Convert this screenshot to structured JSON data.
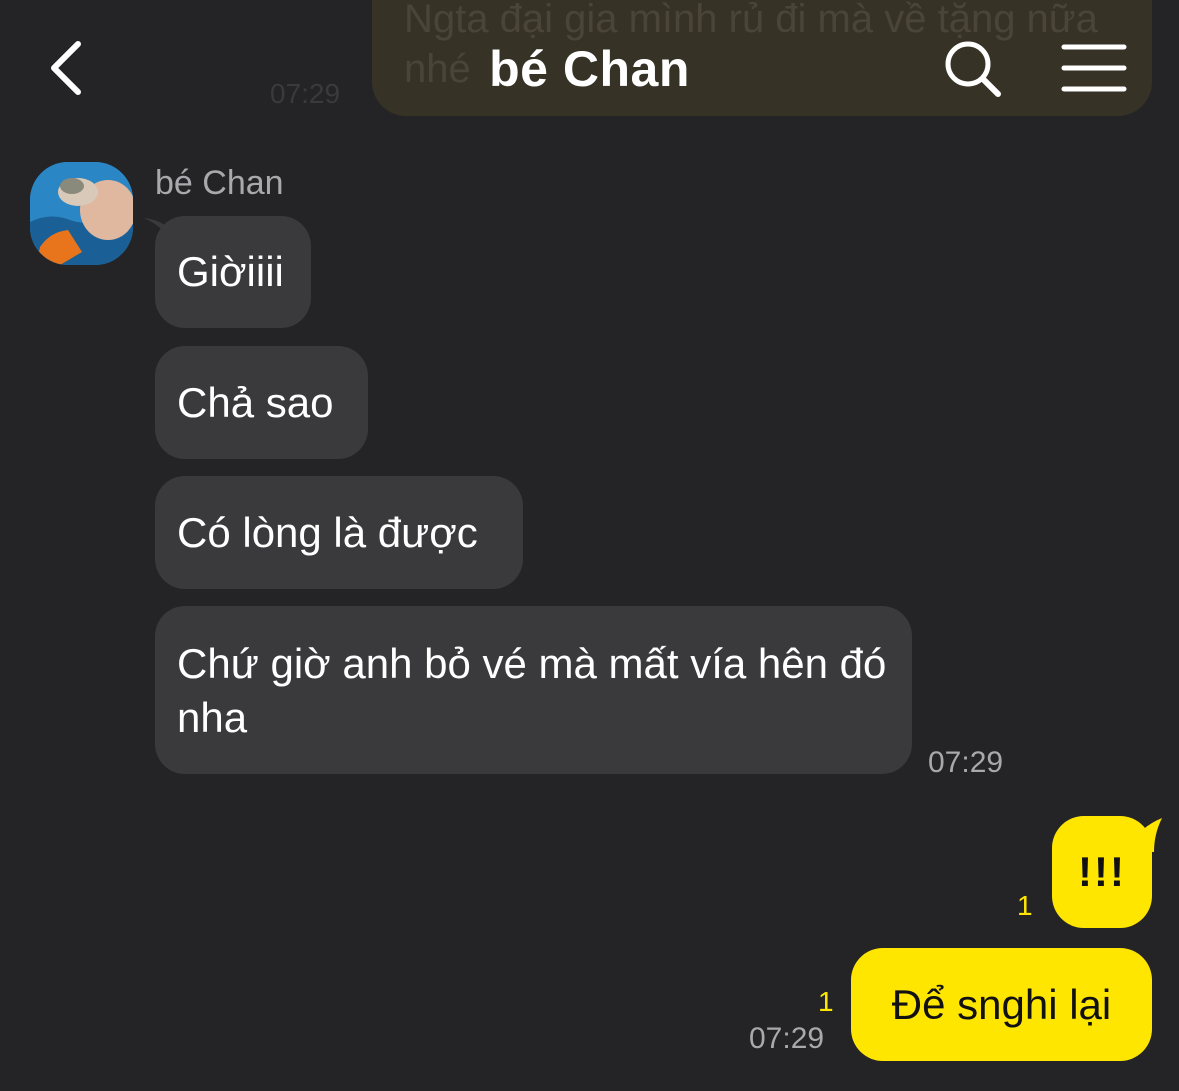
{
  "header": {
    "title": "bé Chan",
    "back_icon": "chevron-left-icon",
    "search_icon": "search-icon",
    "menu_icon": "hamburger-menu-icon"
  },
  "previous": {
    "text": "Ngta đại gia mình rủ đi mà về tặng nữa nhé",
    "time": "07:29"
  },
  "incoming": {
    "sender": "bé Chan",
    "messages": [
      "Giờiiii",
      "Chả sao",
      "Có lòng là được",
      "Chứ giờ anh bỏ vé mà mất vía hên đó nha"
    ],
    "time": "07:29"
  },
  "outgoing": {
    "messages": [
      {
        "text": "!!!",
        "unread": "1"
      },
      {
        "text": "Để snghi lại",
        "unread": "1"
      }
    ],
    "time": "07:29"
  },
  "colors": {
    "background": "#242426",
    "incoming_bubble": "#3a3a3c",
    "outgoing_bubble": "#ffe600",
    "unread_count": "#ffe600",
    "muted_text": "#a8a8ad"
  }
}
